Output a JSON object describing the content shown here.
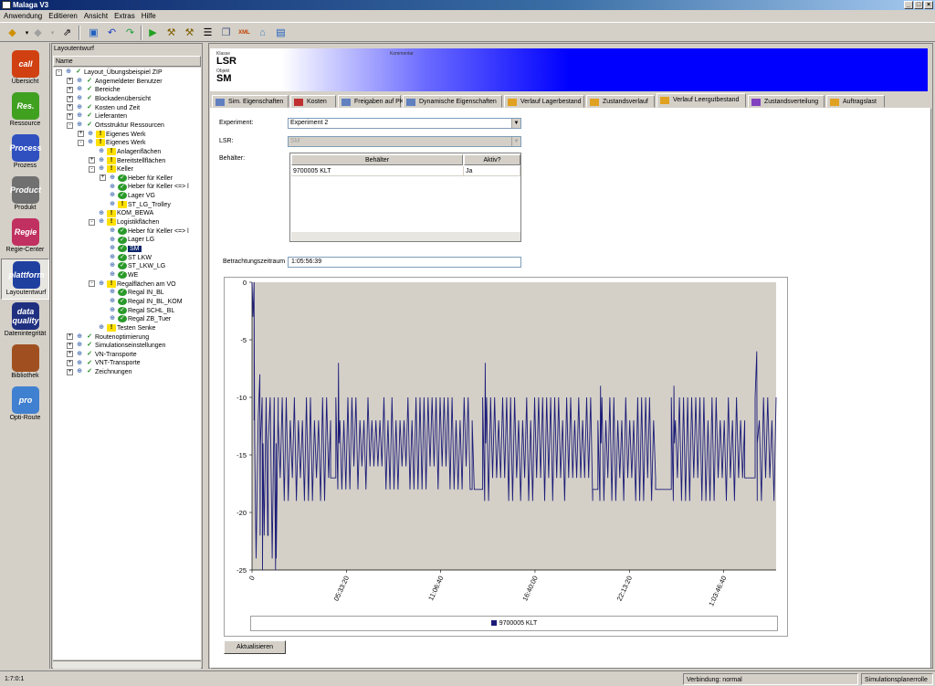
{
  "window": {
    "title": "Malaga V3"
  },
  "menu": [
    "Anwendung",
    "Editieren",
    "Ansicht",
    "Extras",
    "Hilfe"
  ],
  "left_nav": [
    {
      "label": "Übersicht",
      "icon": "overview-icon",
      "badge": "call",
      "color": "#d04010"
    },
    {
      "label": "Ressource",
      "icon": "resource-icon",
      "badge": "Res.",
      "color": "#40a020"
    },
    {
      "label": "Prozess",
      "icon": "process-icon",
      "badge": "Process",
      "color": "#3050c0"
    },
    {
      "label": "Produkt",
      "icon": "product-icon",
      "badge": "Product",
      "color": "#707070"
    },
    {
      "label": "Regie-Center",
      "icon": "regie-center-icon",
      "badge": "Regie",
      "color": "#c03060"
    },
    {
      "label": "Layoutentwurf",
      "icon": "layout-icon",
      "badge": "plattform",
      "color": "#2040a0",
      "selected": true
    },
    {
      "label": "Datenintegrität",
      "icon": "data-quality-icon",
      "badge": "data quality",
      "color": "#203080"
    },
    {
      "label": "Bibliothek",
      "icon": "library-icon",
      "badge": "",
      "color": "#a05020"
    },
    {
      "label": "Opti-Route",
      "icon": "opti-route-icon",
      "badge": "pro",
      "color": "#4080d0"
    }
  ],
  "tree_panel": {
    "title": "Layoutentwurf",
    "column": "Name",
    "nodes": [
      {
        "d": 0,
        "pm": "-",
        "icon": "chk",
        "label": "Layout_Übungsbeispiel ZIP"
      },
      {
        "d": 1,
        "pm": "+",
        "icon": "chk",
        "label": "Angemeldeter Benutzer"
      },
      {
        "d": 1,
        "pm": "+",
        "icon": "chk",
        "label": "Bereiche"
      },
      {
        "d": 1,
        "pm": "+",
        "icon": "chk",
        "label": "Blockadenübersicht"
      },
      {
        "d": 1,
        "pm": "+",
        "icon": "chk",
        "label": "Kosten und Zeit"
      },
      {
        "d": 1,
        "pm": "+",
        "icon": "chk",
        "label": "Lieferanten"
      },
      {
        "d": 1,
        "pm": "-",
        "icon": "chk",
        "label": "Ortsstruktur Ressourcen"
      },
      {
        "d": 2,
        "pm": "+",
        "icon": "warn",
        "label": "Eigenes Werk"
      },
      {
        "d": 2,
        "pm": "-",
        "icon": "warn",
        "label": "Eigenes Werk"
      },
      {
        "d": 3,
        "pm": "",
        "icon": "warn",
        "label": "Anlagenflächen"
      },
      {
        "d": 3,
        "pm": "+",
        "icon": "warn",
        "label": "Bereitstellflächen"
      },
      {
        "d": 3,
        "pm": "-",
        "icon": "warn",
        "label": "Keller"
      },
      {
        "d": 4,
        "pm": "+",
        "icon": "ok",
        "label": "Heber für Keller"
      },
      {
        "d": 4,
        "pm": "",
        "icon": "ok",
        "label": "Heber für Keller <=> l"
      },
      {
        "d": 4,
        "pm": "",
        "icon": "ok",
        "label": "Lager VG"
      },
      {
        "d": 4,
        "pm": "",
        "icon": "warn",
        "label": "ST_LG_Trolley"
      },
      {
        "d": 3,
        "pm": "",
        "icon": "warn",
        "label": "KOM_BEWA"
      },
      {
        "d": 3,
        "pm": "-",
        "icon": "warn",
        "label": "Logistikflächen"
      },
      {
        "d": 4,
        "pm": "",
        "icon": "ok",
        "label": "Heber für Keller <=> l"
      },
      {
        "d": 4,
        "pm": "",
        "icon": "ok",
        "label": "Lager LG"
      },
      {
        "d": 4,
        "pm": "",
        "icon": "ok",
        "label": "SM",
        "selected": true
      },
      {
        "d": 4,
        "pm": "",
        "icon": "ok",
        "label": "ST LKW"
      },
      {
        "d": 4,
        "pm": "",
        "icon": "ok",
        "label": "ST_LKW_LG"
      },
      {
        "d": 4,
        "pm": "",
        "icon": "ok",
        "label": "WE"
      },
      {
        "d": 3,
        "pm": "-",
        "icon": "warn",
        "label": "Regalflächen am VO"
      },
      {
        "d": 4,
        "pm": "",
        "icon": "ok",
        "label": "Regal IN_BL"
      },
      {
        "d": 4,
        "pm": "",
        "icon": "ok",
        "label": "Regal IN_BL_KOM"
      },
      {
        "d": 4,
        "pm": "",
        "icon": "ok",
        "label": "Regal SCHL_BL"
      },
      {
        "d": 4,
        "pm": "",
        "icon": "ok",
        "label": "Regal ZB_Tuer"
      },
      {
        "d": 3,
        "pm": "",
        "icon": "warn",
        "label": "Testen Senke"
      },
      {
        "d": 1,
        "pm": "+",
        "icon": "chk",
        "label": "Routenoptimierung"
      },
      {
        "d": 1,
        "pm": "+",
        "icon": "chk",
        "label": "Simulationseinstellungen"
      },
      {
        "d": 1,
        "pm": "+",
        "icon": "chk",
        "label": "VN-Transporte"
      },
      {
        "d": 1,
        "pm": "+",
        "icon": "chk",
        "label": "VNT-Transporte"
      },
      {
        "d": 1,
        "pm": "+",
        "icon": "chk",
        "label": "Zeichnungen"
      }
    ]
  },
  "header": {
    "class_caption": "Klasse",
    "class_value": "LSR",
    "object_caption": "Objekt",
    "object_value": "SM",
    "comment_caption": "Kommentar"
  },
  "tabs": [
    {
      "label": "Sim. Eigenschaften",
      "active": false
    },
    {
      "label": "Kosten",
      "active": false
    },
    {
      "label": "Freigaben auf PK",
      "active": false
    },
    {
      "label": "Dynamische Eigenschaften",
      "active": false
    },
    {
      "label": "Verlauf Lagerbestand",
      "active": false
    },
    {
      "label": "Zustandsverlauf",
      "active": false
    },
    {
      "label": "Verlauf Leergutbestand",
      "active": true
    },
    {
      "label": "Zustandsverteilung",
      "active": false
    },
    {
      "label": "Auftragslast",
      "active": false
    }
  ],
  "form": {
    "experiment_label": "Experiment:",
    "experiment_value": "Experiment 2",
    "lsr_label": "LSR:",
    "lsr_value": "SM",
    "behaelter_label": "Behälter:",
    "grid_headers": [
      "Behälter",
      "Aktiv?"
    ],
    "grid_rows": [
      [
        "9700005 KLT",
        "Ja"
      ]
    ],
    "zeitraum_label": "Betrachtungszeitraum",
    "zeitraum_value": "1:05:56:39",
    "refresh_label": "Aktualisieren"
  },
  "chart_data": {
    "type": "line",
    "title": "",
    "xlabel": "",
    "ylabel": "",
    "ylim": [
      -25,
      0
    ],
    "y_ticks": [
      "0",
      "-5",
      "-10",
      "-15",
      "-20",
      "-25"
    ],
    "x_ticks": [
      "0",
      "05:33:20",
      "11:06:40",
      "16:40:00",
      "22:13:20",
      "1:03:46:40"
    ],
    "series": [
      {
        "name": "9700005 KLT",
        "color": "#1c1c78"
      }
    ],
    "segments": [
      {
        "x0": 0.0,
        "x1": 0.004,
        "low": -5,
        "high": 0
      },
      {
        "x0": 0.004,
        "x1": 0.05,
        "low": -24,
        "high": -10
      },
      {
        "x0": 0.05,
        "x1": 0.15,
        "low": -19,
        "high": -10
      },
      {
        "x0": 0.15,
        "x1": 0.16,
        "low": -17,
        "high": -17
      },
      {
        "x0": 0.16,
        "x1": 0.42,
        "low": -18,
        "high": -10
      },
      {
        "x0": 0.42,
        "x1": 0.44,
        "low": -18,
        "high": -18
      },
      {
        "x0": 0.44,
        "x1": 0.65,
        "low": -19,
        "high": -10
      },
      {
        "x0": 0.65,
        "x1": 0.66,
        "low": -18,
        "high": -18
      },
      {
        "x0": 0.66,
        "x1": 0.77,
        "low": -19,
        "high": -10
      },
      {
        "x0": 0.77,
        "x1": 0.8,
        "low": -18,
        "high": -18
      },
      {
        "x0": 0.8,
        "x1": 0.94,
        "low": -19,
        "high": -10
      },
      {
        "x0": 0.94,
        "x1": 0.96,
        "low": -17,
        "high": -17
      },
      {
        "x0": 0.96,
        "x1": 1.0,
        "low": -19,
        "high": -10
      }
    ],
    "spikes": [
      {
        "x": 0.004,
        "y": -2
      },
      {
        "x": 0.015,
        "y": -8
      },
      {
        "x": 0.165,
        "y": -7
      },
      {
        "x": 0.445,
        "y": -7
      },
      {
        "x": 0.665,
        "y": -9
      },
      {
        "x": 0.805,
        "y": -9
      },
      {
        "x": 0.963,
        "y": -6
      }
    ],
    "dips": [
      {
        "x": 0.02,
        "y": -25
      },
      {
        "x": 0.045,
        "y": -25
      },
      {
        "x": 0.03,
        "y": -22
      }
    ],
    "grid": false,
    "legend_position": "bottom"
  },
  "status": {
    "left": "1:7:0:1",
    "connection": "Verbindung: normal",
    "mode": "Simulationsplanerrolle"
  },
  "colors": {
    "title_bar": "#0a246a",
    "header_blue": "#0000ff",
    "series": "#1c1c78",
    "plot_bg": "#d4d0c8"
  }
}
